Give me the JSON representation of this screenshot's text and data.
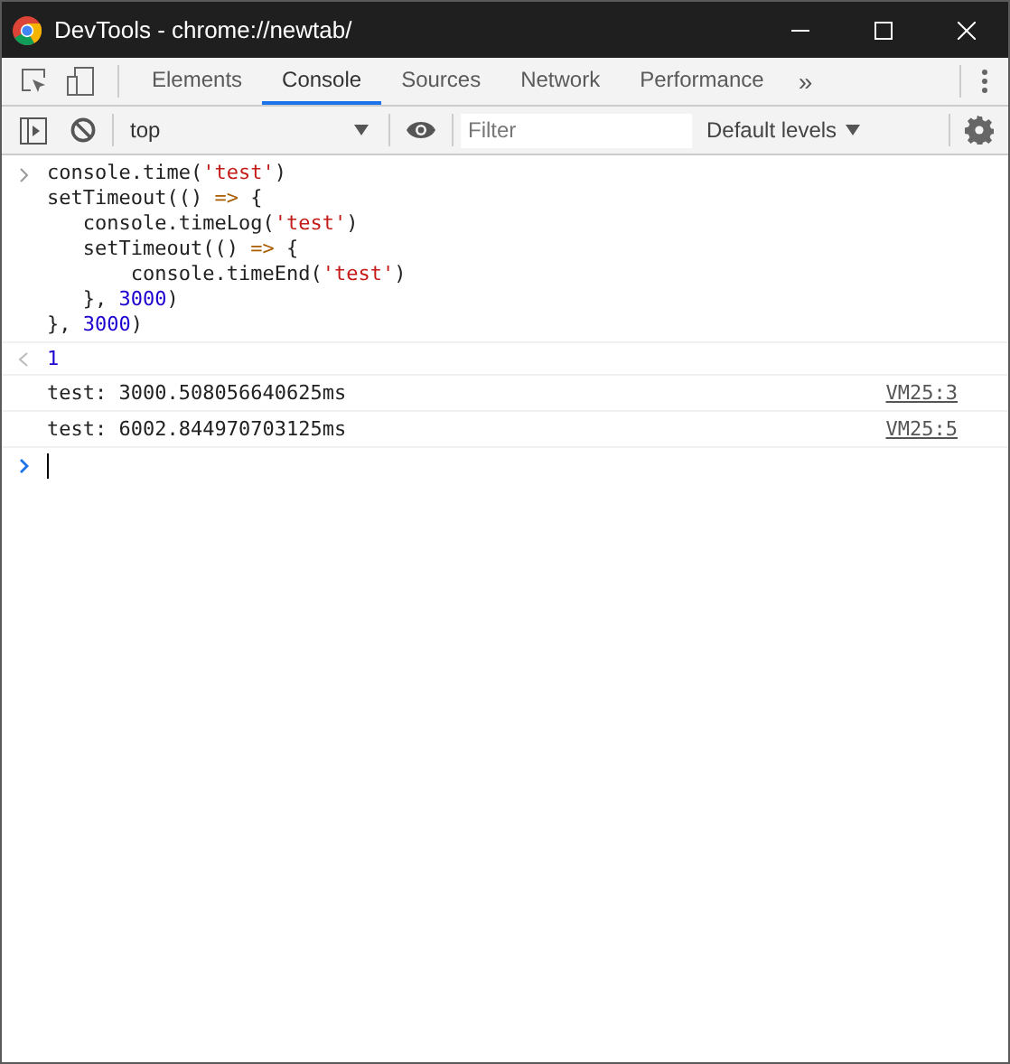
{
  "window": {
    "title": "DevTools - chrome://newtab/"
  },
  "tabs": [
    {
      "label": "Elements",
      "selected": false
    },
    {
      "label": "Console",
      "selected": true
    },
    {
      "label": "Sources",
      "selected": false
    },
    {
      "label": "Network",
      "selected": false
    },
    {
      "label": "Performance",
      "selected": false
    }
  ],
  "overflow": "»",
  "toolbar": {
    "context": "top",
    "filter_placeholder": "Filter",
    "levels": "Default levels"
  },
  "input": {
    "lines": [
      [
        {
          "kind": "plain",
          "text": "console.time("
        },
        {
          "kind": "string",
          "text": "'test'"
        },
        {
          "kind": "plain",
          "text": ")"
        }
      ],
      [
        {
          "kind": "plain",
          "text": "setTimeout(() "
        },
        {
          "kind": "operator",
          "text": "=>"
        },
        {
          "kind": "plain",
          "text": " {"
        }
      ],
      [
        {
          "kind": "plain",
          "text": "   console.timeLog("
        },
        {
          "kind": "string",
          "text": "'test'"
        },
        {
          "kind": "plain",
          "text": ")"
        }
      ],
      [
        {
          "kind": "plain",
          "text": "   setTimeout(() "
        },
        {
          "kind": "operator",
          "text": "=>"
        },
        {
          "kind": "plain",
          "text": " {"
        }
      ],
      [
        {
          "kind": "plain",
          "text": "       console.timeEnd("
        },
        {
          "kind": "string",
          "text": "'test'"
        },
        {
          "kind": "plain",
          "text": ")"
        }
      ],
      [
        {
          "kind": "plain",
          "text": "   }, "
        },
        {
          "kind": "number",
          "text": "3000"
        },
        {
          "kind": "plain",
          "text": ")"
        }
      ],
      [
        {
          "kind": "plain",
          "text": "}, "
        },
        {
          "kind": "number",
          "text": "3000"
        },
        {
          "kind": "plain",
          "text": ")"
        }
      ]
    ]
  },
  "result": "1",
  "messages": [
    {
      "text": "test: 3000.508056640625ms",
      "source": "VM25:3"
    },
    {
      "text": "test: 6002.844970703125ms",
      "source": "VM25:5"
    }
  ]
}
